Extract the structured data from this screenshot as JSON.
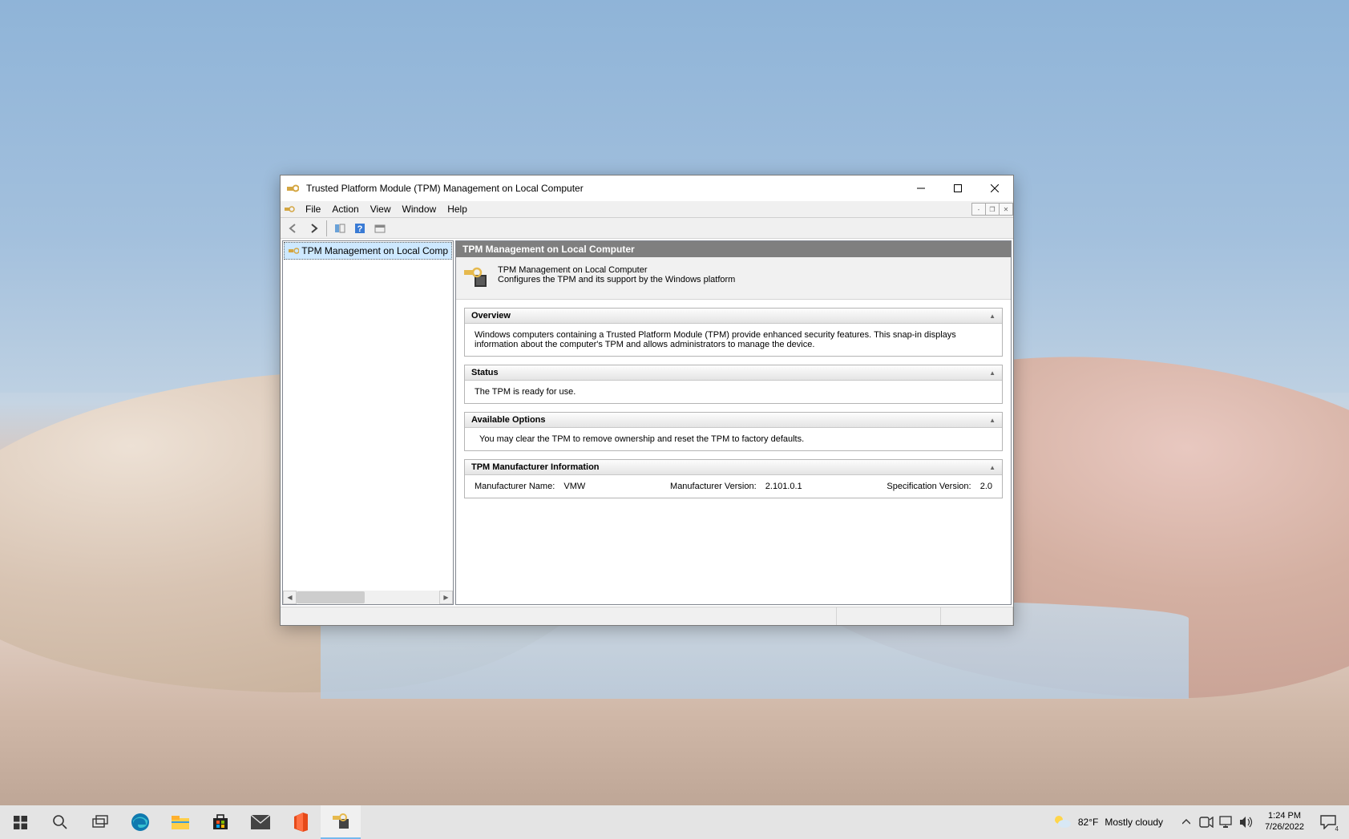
{
  "window": {
    "title": "Trusted Platform Module (TPM) Management on Local Computer",
    "menus": {
      "file": "File",
      "action": "Action",
      "view": "View",
      "window": "Window",
      "help": "Help"
    }
  },
  "tree": {
    "item": "TPM Management on Local Comp"
  },
  "content": {
    "header": "TPM Management on Local Computer",
    "intro_line1": "TPM Management on Local Computer",
    "intro_line2": "Configures the TPM and its support by the Windows platform",
    "overview": {
      "title": "Overview",
      "text": "Windows computers containing a Trusted Platform Module (TPM) provide enhanced security features. This snap-in displays information about the computer's TPM and allows administrators to manage the device."
    },
    "status": {
      "title": "Status",
      "text": "The TPM is ready for use."
    },
    "options": {
      "title": "Available Options",
      "text": "You may clear the TPM to remove ownership and reset the TPM to factory defaults."
    },
    "mfr": {
      "title": "TPM Manufacturer Information",
      "name_label": "Manufacturer Name:",
      "name_value": "VMW",
      "ver_label": "Manufacturer Version:",
      "ver_value": "2.101.0.1",
      "spec_label": "Specification Version:",
      "spec_value": "2.0"
    }
  },
  "taskbar": {
    "weather_temp": "82°F",
    "weather_desc": "Mostly cloudy",
    "time": "1:24 PM",
    "date": "7/26/2022",
    "notif_count": "4"
  }
}
